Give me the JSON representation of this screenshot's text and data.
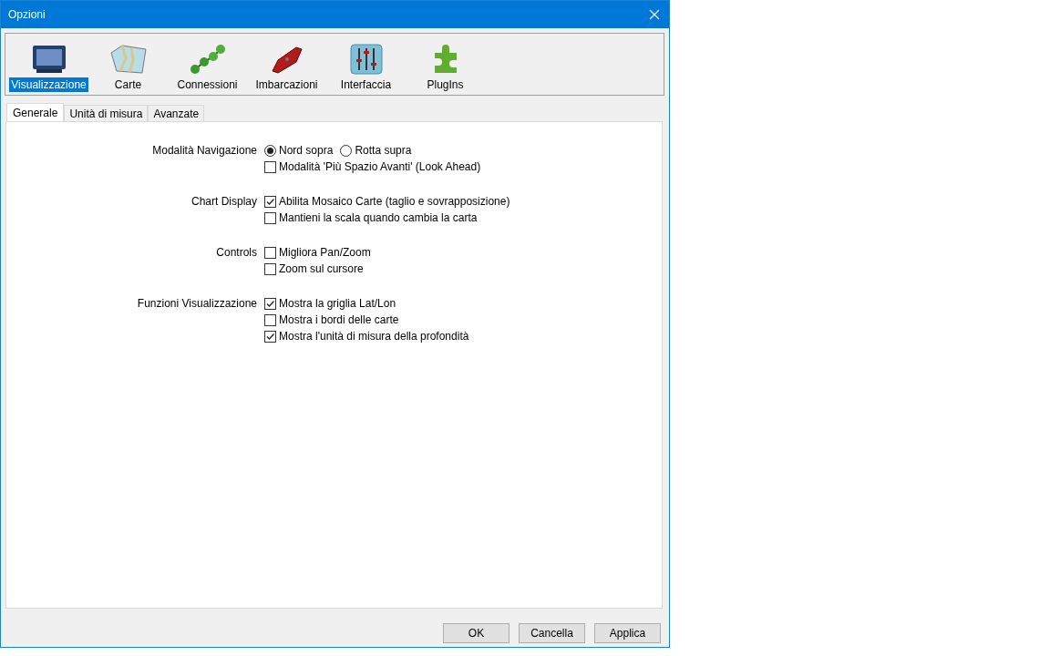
{
  "window": {
    "title": "Opzioni"
  },
  "toolbar": [
    {
      "label": "Visualizzazione",
      "kind": "monitor",
      "selected": true
    },
    {
      "label": "Carte",
      "kind": "map",
      "selected": false
    },
    {
      "label": "Connessioni",
      "kind": "nodes",
      "selected": false
    },
    {
      "label": "Imbarcazioni",
      "kind": "boat",
      "selected": false
    },
    {
      "label": "Interfaccia",
      "kind": "sliders",
      "selected": false
    },
    {
      "label": "PlugIns",
      "kind": "puzzle",
      "selected": false
    }
  ],
  "tabs": [
    {
      "label": "Generale",
      "selected": true
    },
    {
      "label": "Unità di misura",
      "selected": false
    },
    {
      "label": "Avanzate",
      "selected": false
    }
  ],
  "groups": [
    {
      "label": "Modalità Navigazione",
      "rows": [
        [
          {
            "kind": "radio",
            "label": "Nord sopra",
            "selected": true
          },
          {
            "kind": "radio",
            "label": "Rotta supra",
            "selected": false
          }
        ],
        [
          {
            "kind": "checkbox",
            "label": "Modalità 'Più Spazio Avanti' (Look Ahead)",
            "checked": false
          }
        ]
      ]
    },
    {
      "label": "Chart Display",
      "rows": [
        [
          {
            "kind": "checkbox",
            "label": "Abilita Mosaico Carte (taglio e sovrapposizione)",
            "checked": true
          }
        ],
        [
          {
            "kind": "checkbox",
            "label": "Mantieni la scala quando cambia la carta",
            "checked": false
          }
        ]
      ]
    },
    {
      "label": "Controls",
      "rows": [
        [
          {
            "kind": "checkbox",
            "label": "Migliora Pan/Zoom",
            "checked": false
          }
        ],
        [
          {
            "kind": "checkbox",
            "label": "Zoom sul cursore",
            "checked": false
          }
        ]
      ]
    },
    {
      "label": "Funzioni Visualizzazione",
      "rows": [
        [
          {
            "kind": "checkbox",
            "label": "Mostra la griglia Lat/Lon",
            "checked": true
          }
        ],
        [
          {
            "kind": "checkbox",
            "label": "Mostra i bordi delle carte",
            "checked": false
          }
        ],
        [
          {
            "kind": "checkbox",
            "label": "Mostra l'unità di misura della profondità",
            "checked": true
          }
        ]
      ]
    }
  ],
  "buttons": [
    "OK",
    "Cancella",
    "Applica"
  ]
}
